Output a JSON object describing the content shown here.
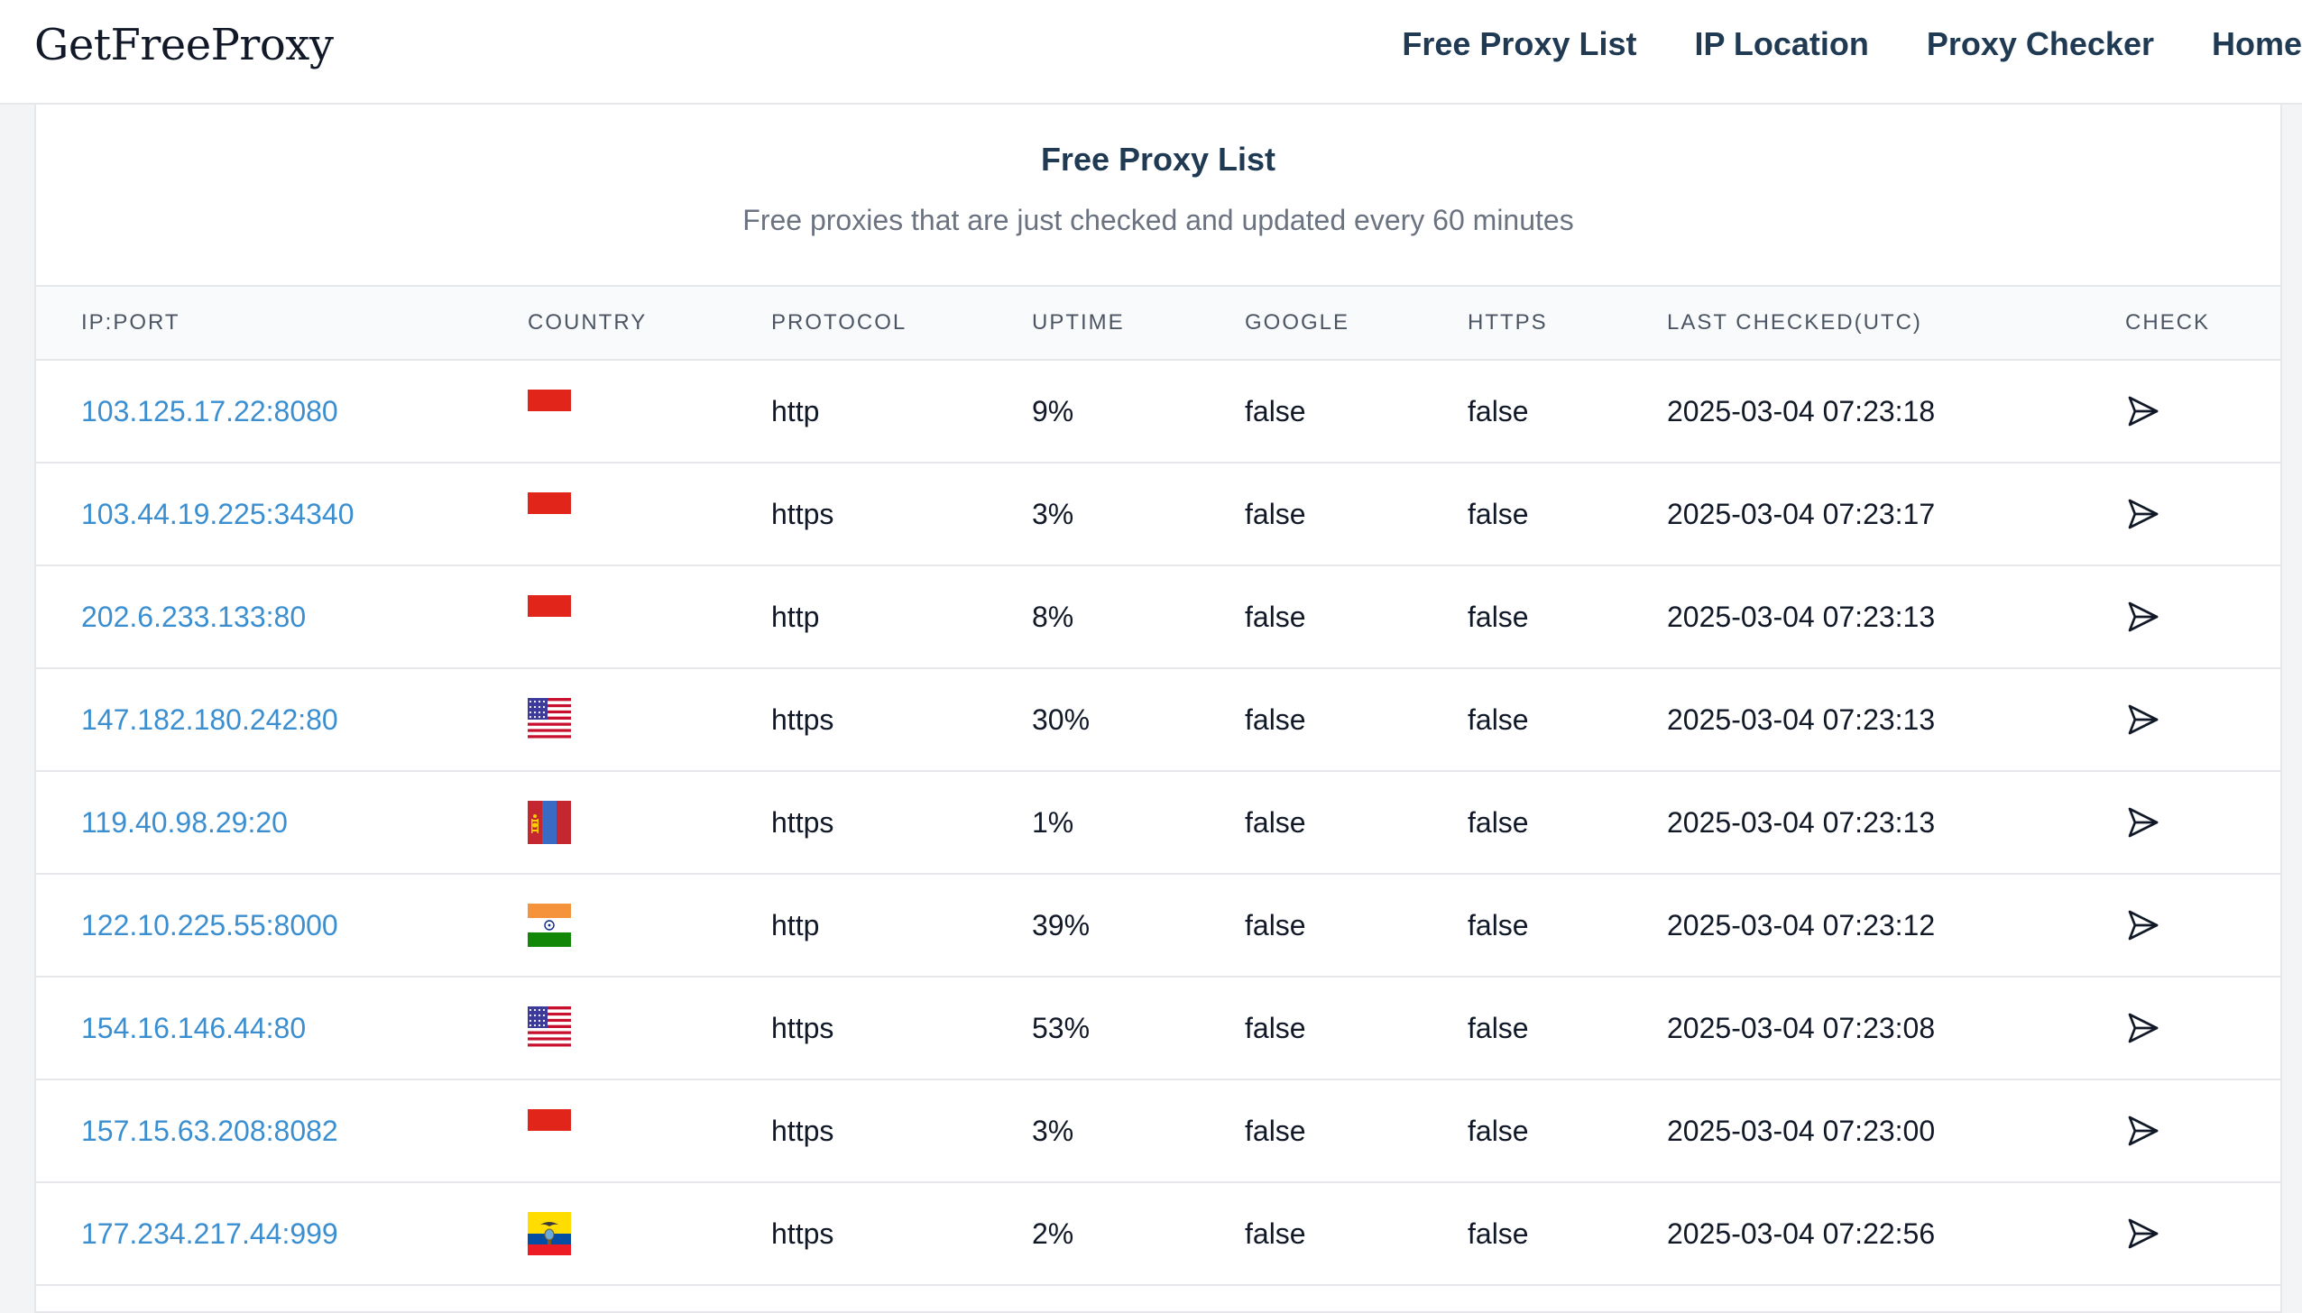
{
  "header": {
    "brand": "GetFreeProxy",
    "nav": [
      {
        "label": "Free Proxy List"
      },
      {
        "label": "IP Location"
      },
      {
        "label": "Proxy Checker"
      },
      {
        "label": "Home"
      }
    ]
  },
  "main": {
    "title": "Free Proxy List",
    "subtitle": "Free proxies that are just checked and updated every 60 minutes",
    "columns": [
      "IP:PORT",
      "COUNTRY",
      "PROTOCOL",
      "UPTIME",
      "GOOGLE",
      "HTTPS",
      "LAST CHECKED(UTC)",
      "CHECK"
    ],
    "rows": [
      {
        "ip": "103.125.17.22:8080",
        "flag": "indonesia-flag-icon",
        "protocol": "http",
        "uptime": "9%",
        "google": "false",
        "https": "false",
        "checked": "2025-03-04 07:23:18"
      },
      {
        "ip": "103.44.19.225:34340",
        "flag": "indonesia-flag-icon",
        "protocol": "https",
        "uptime": "3%",
        "google": "false",
        "https": "false",
        "checked": "2025-03-04 07:23:17"
      },
      {
        "ip": "202.6.233.133:80",
        "flag": "indonesia-flag-icon",
        "protocol": "http",
        "uptime": "8%",
        "google": "false",
        "https": "false",
        "checked": "2025-03-04 07:23:13"
      },
      {
        "ip": "147.182.180.242:80",
        "flag": "usa-flag-icon",
        "protocol": "https",
        "uptime": "30%",
        "google": "false",
        "https": "false",
        "checked": "2025-03-04 07:23:13"
      },
      {
        "ip": "119.40.98.29:20",
        "flag": "mongolia-flag-icon",
        "protocol": "https",
        "uptime": "1%",
        "google": "false",
        "https": "false",
        "checked": "2025-03-04 07:23:13"
      },
      {
        "ip": "122.10.225.55:8000",
        "flag": "india-flag-icon",
        "protocol": "http",
        "uptime": "39%",
        "google": "false",
        "https": "false",
        "checked": "2025-03-04 07:23:12"
      },
      {
        "ip": "154.16.146.44:80",
        "flag": "usa-flag-icon",
        "protocol": "https",
        "uptime": "53%",
        "google": "false",
        "https": "false",
        "checked": "2025-03-04 07:23:08"
      },
      {
        "ip": "157.15.63.208:8082",
        "flag": "indonesia-flag-icon",
        "protocol": "https",
        "uptime": "3%",
        "google": "false",
        "https": "false",
        "checked": "2025-03-04 07:23:00"
      },
      {
        "ip": "177.234.217.44:999",
        "flag": "ecuador-flag-icon",
        "protocol": "https",
        "uptime": "2%",
        "google": "false",
        "https": "false",
        "checked": "2025-03-04 07:22:56"
      }
    ]
  },
  "colors": {
    "link": "#3b8fd0",
    "heading": "#1f3a52",
    "border": "#e5e7eb"
  }
}
